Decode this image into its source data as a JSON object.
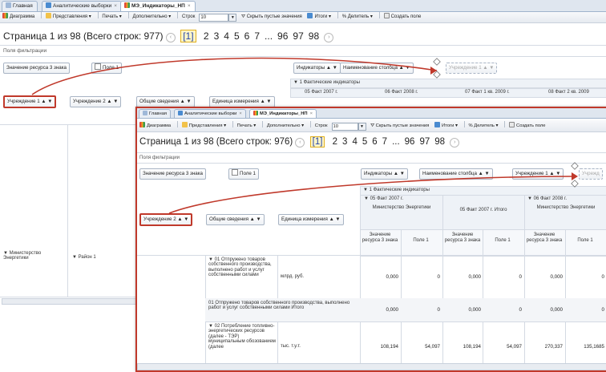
{
  "back": {
    "tabs": [
      {
        "label": "Главная",
        "icon": "home-icon"
      },
      {
        "label": "Аналитические выборки",
        "icon": "table-icon"
      },
      {
        "label": "МЭ_Индикаторы_НП",
        "icon": "chart-icon"
      }
    ],
    "toolbar": {
      "diagram": "Диаграмма",
      "views": "Представления",
      "print": "Печать",
      "extra": "Дополнительно",
      "rows_label": "Строк",
      "rows_value": "10",
      "hide_empty": "Скрыть пустые значения",
      "totals": "Итоги",
      "divider": "Делитель",
      "create_field": "Создать поле"
    },
    "pager": {
      "text": "Страница 1 из 98 (Всего строк: 977)",
      "current": "[1]",
      "pages": [
        "2",
        "3",
        "4",
        "5",
        "6",
        "7",
        "...",
        "96",
        "97",
        "98"
      ]
    },
    "filter_label": "Поля фильтрации",
    "filter_fields": [
      "Значение ресурса 3 знака",
      "Поле 1"
    ],
    "column_fields": [
      "Индикаторы ▲ ▼",
      "Наименование столбца ▲ ▼",
      "Учреждение 1 ▲ ▼"
    ],
    "group_row": "▼ 1 Фактические индикаторы",
    "periods": [
      "05 Факт 2007 г.",
      "06 Факт 2008 г.",
      "07 Факт 1 кв. 2009 г.",
      "08 Факт 2 кв. 2009"
    ],
    "row_fields": [
      "Учреждение 1 ▲ ▼",
      "Учреждение 2 ▲ ▼",
      "Общие сведения ▲ ▼",
      "Единица измерения ▲ ▼"
    ],
    "left_row": {
      "a": "▼ Министерство Энергетики",
      "b": "▼ Район 1"
    }
  },
  "front": {
    "tabs": [
      {
        "label": "Главная",
        "icon": "home-icon"
      },
      {
        "label": "Аналитические выборки",
        "icon": "table-icon"
      },
      {
        "label": "МЭ_Индикаторы_НП",
        "icon": "chart-icon"
      }
    ],
    "toolbar": {
      "diagram": "Диаграмма",
      "views": "Представления",
      "print": "Печать",
      "extra": "Дополнительно",
      "rows_label": "Строк",
      "rows_value": "10",
      "hide_empty": "Скрыть пустые значения",
      "totals": "Итоги",
      "divider": "Делитель",
      "create_field": "Создать поле"
    },
    "pager": {
      "text": "Страница 1 из 98 (Всего строк: 976)",
      "current": "[1]",
      "pages": [
        "2",
        "3",
        "4",
        "5",
        "6",
        "7",
        "...",
        "96",
        "97",
        "98"
      ]
    },
    "filter_label": "Поля фильтрации",
    "filter_fields": [
      "Значение ресурса 3 знака",
      "Поле 1"
    ],
    "column_fields": [
      "Индикаторы ▲ ▼",
      "Наименование столбца ▲ ▼",
      "Учреждение 1 ▲ ▼",
      "Учрежд"
    ],
    "group_row": "▼ 1 Фактические индикаторы",
    "period1": "▼ 05 Факт 2007 г.",
    "period1_total": "05 Факт 2007 г. Итого",
    "period2": "▼ 06 Факт 2008 г.",
    "ministry": "Министерство Энергетики",
    "row_fields": [
      "Учреждение 2 ▲ ▼",
      "Общие сведения ▲ ▼",
      "Единица измерения ▲ ▼"
    ],
    "measure_headers": [
      "Значение ресурса 3 знака",
      "Поле 1",
      "Значение ресурса 3 знака",
      "Поле 1",
      "Значение ресурса 3 знака",
      "Поле 1"
    ],
    "rows": [
      {
        "label": "▼ 01 Отпружено товаров собственного производства, выполнено работ и услуг собственными силами",
        "unit": "млрд. руб.",
        "values": [
          "0,000",
          "0",
          "0,000",
          "0",
          "0,000",
          "0"
        ]
      },
      {
        "label": "01 Отпружено товаров собственного производства, выполнено работ и услуг собственными силами Итого",
        "unit": "",
        "values": [
          "0,000",
          "0",
          "0,000",
          "0",
          "0,000",
          "0"
        ]
      },
      {
        "label": "▼ 02 Потребление топливно-энергетических ресурсов (далее - ТЭР) муниципальным обозованием (далее",
        "unit": "тыс. т.у.т.",
        "values": [
          "108,194",
          "54,097",
          "108,194",
          "54,097",
          "270,337",
          "135,1685"
        ]
      }
    ]
  },
  "colors": {
    "highlight": "#c0392b",
    "header_band": "#eef2f7",
    "link": "#2244aa"
  }
}
